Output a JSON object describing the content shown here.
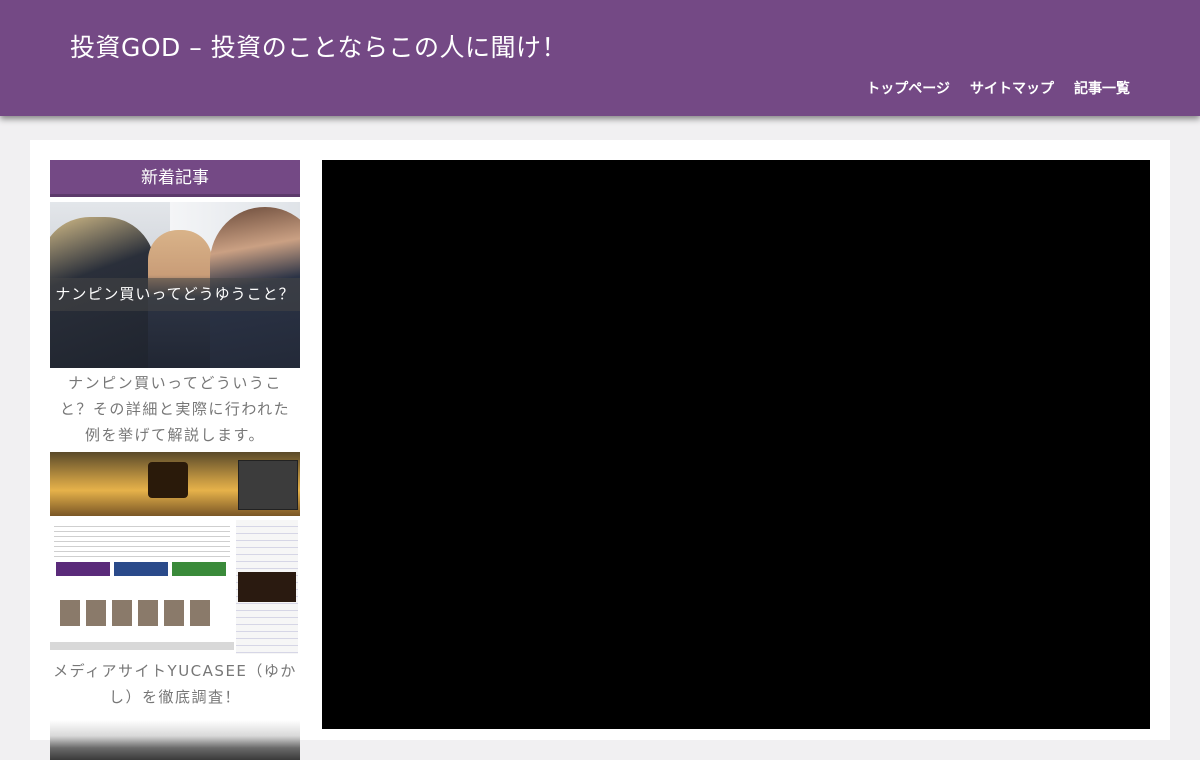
{
  "header": {
    "site_title": "投資GOD – 投資のことならこの人に聞け！",
    "nav": [
      "トップページ",
      "サイトマップ",
      "記事一覧"
    ]
  },
  "sidebar": {
    "widget_title": "新着記事",
    "posts": [
      {
        "image_caption": "ナンピン買いってどうゆうこと？",
        "title": "ナンピン買いってどういうこと？その詳細と実際に行われた例を挙げて解説します。"
      },
      {
        "title": "メディアサイトYUCASEE（ゆかし）を徹底調査！"
      }
    ]
  },
  "colors": {
    "header_bg": "#744985",
    "page_bg": "#f1f0f2",
    "video_bg": "#000000"
  }
}
